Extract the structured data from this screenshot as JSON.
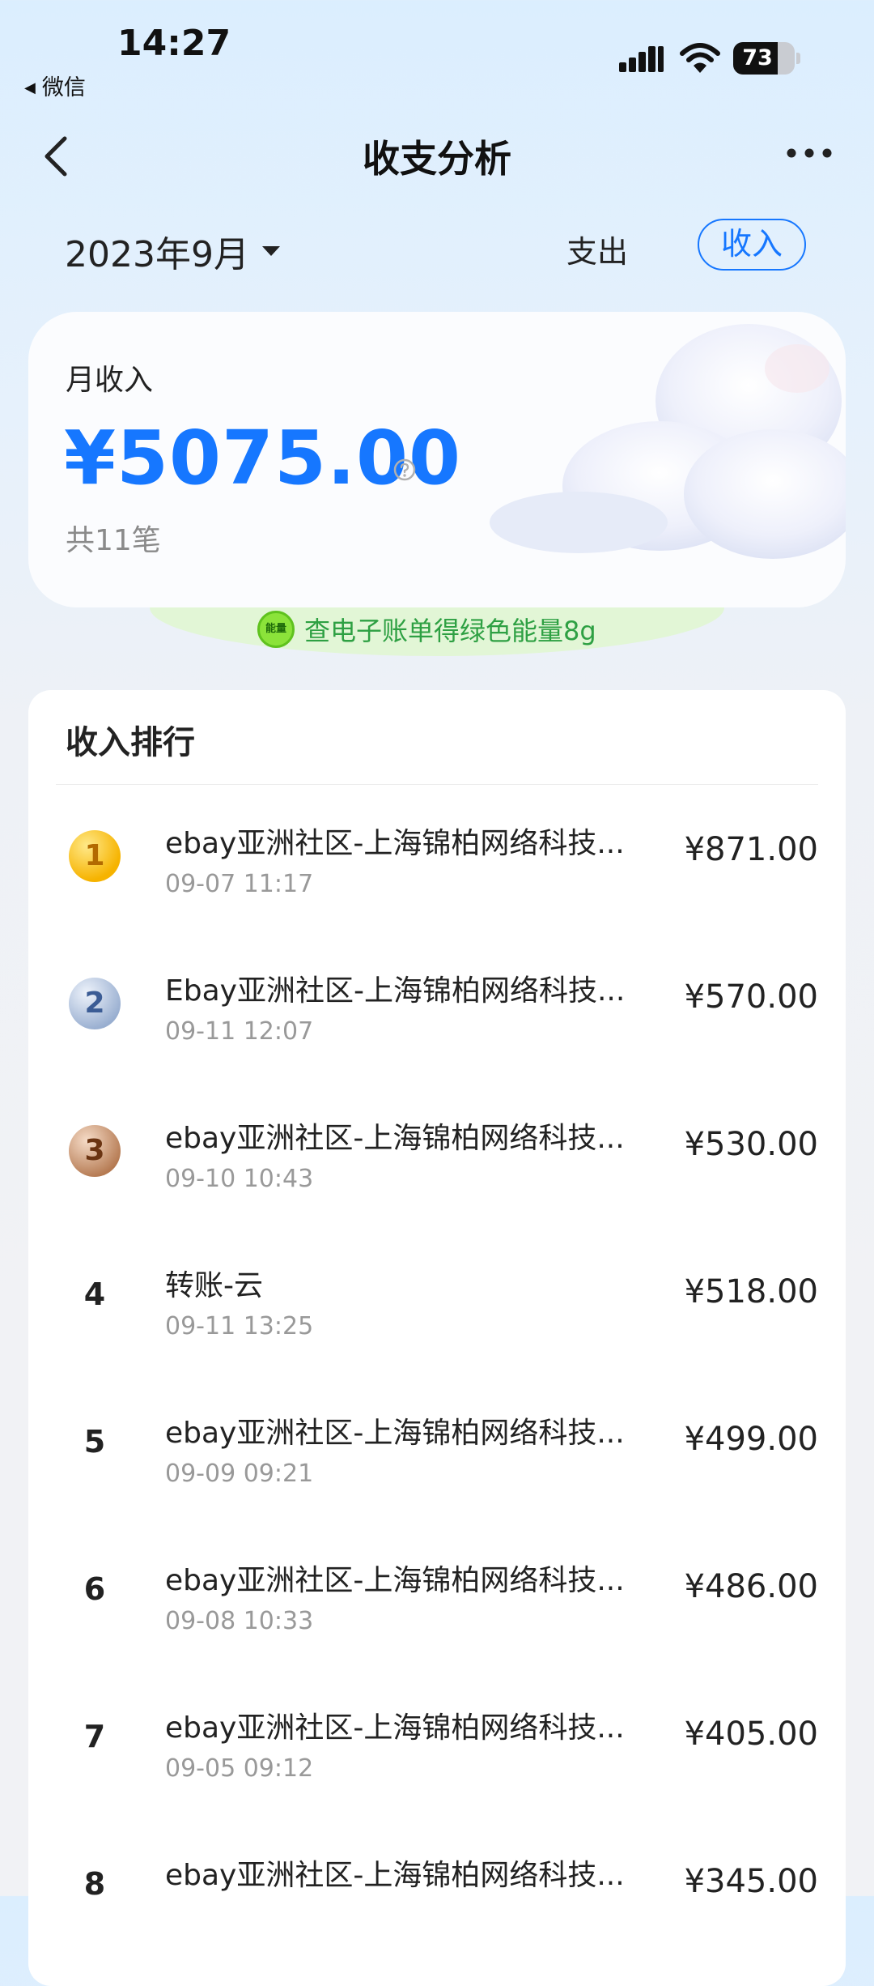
{
  "status_bar": {
    "time": "14:27",
    "back_app": "微信",
    "battery": "73",
    "battery_level": 0.73
  },
  "nav": {
    "title": "收支分析"
  },
  "filter": {
    "month": "2023年9月",
    "tab_expense": "支出",
    "tab_income": "收入",
    "active_tab": "收入"
  },
  "summary": {
    "label": "月收入",
    "amount": "¥5075.00",
    "count": "共11笔"
  },
  "energy_banner": {
    "badge": "能量",
    "text": "查电子账单得绿色能量8g"
  },
  "ranking": {
    "title": "收入排行",
    "items": [
      {
        "rank": "1",
        "title": "ebay亚洲社区-上海锦柏网络科技...",
        "time": "09-07 11:17",
        "amount": "¥871.00"
      },
      {
        "rank": "2",
        "title": "Ebay亚洲社区-上海锦柏网络科技...",
        "time": "09-11 12:07",
        "amount": "¥570.00"
      },
      {
        "rank": "3",
        "title": "ebay亚洲社区-上海锦柏网络科技...",
        "time": "09-10 10:43",
        "amount": "¥530.00"
      },
      {
        "rank": "4",
        "title": "转账-云",
        "time": "09-11 13:25",
        "amount": "¥518.00"
      },
      {
        "rank": "5",
        "title": "ebay亚洲社区-上海锦柏网络科技...",
        "time": "09-09 09:21",
        "amount": "¥499.00"
      },
      {
        "rank": "6",
        "title": "ebay亚洲社区-上海锦柏网络科技...",
        "time": "09-08 10:33",
        "amount": "¥486.00"
      },
      {
        "rank": "7",
        "title": "ebay亚洲社区-上海锦柏网络科技...",
        "time": "09-05 09:12",
        "amount": "¥405.00"
      },
      {
        "rank": "8",
        "title": "ebay亚洲社区-上海锦柏网络科技...",
        "time": "",
        "amount": "¥345.00"
      }
    ]
  },
  "colors": {
    "accent": "#1677ff",
    "energy_green": "#2ea043"
  }
}
